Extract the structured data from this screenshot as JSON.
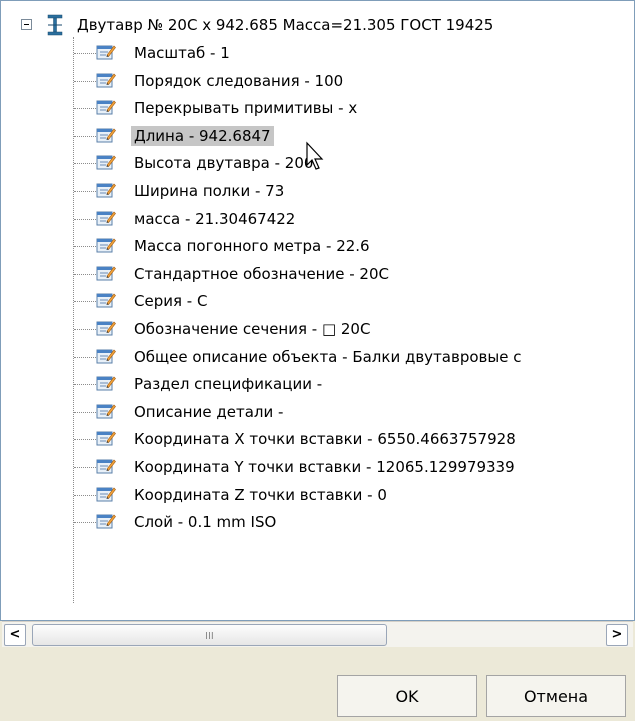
{
  "tree": {
    "root_label": "Двутавр № 20С x 942.685 Масса=21.305 ГОСТ 19425",
    "items": [
      {
        "label": "Масштаб - 1"
      },
      {
        "label": "Порядок следования - 100"
      },
      {
        "label": "Перекрывать примитивы - x"
      },
      {
        "label": "Длина - 942.6847",
        "selected": true
      },
      {
        "label": "Высота двутавра - 200"
      },
      {
        "label": "Ширина полки - 73"
      },
      {
        "label": "масса - 21.30467422"
      },
      {
        "label": "Масса погонного метра - 22.6"
      },
      {
        "label": "Стандартное обозначение - 20С"
      },
      {
        "label": "Серия - С"
      },
      {
        "label": "Обозначение сечения - □ 20С"
      },
      {
        "label": "Общее описание объекта - Балки двутавровые с"
      },
      {
        "label": "Раздел спецификации -"
      },
      {
        "label": "Описание детали -"
      },
      {
        "label": "Координата X точки вставки - 6550.4663757928"
      },
      {
        "label": "Координата Y точки вставки - 12065.129979339"
      },
      {
        "label": "Координата Z точки вставки - 0"
      },
      {
        "label": "Слой - 0.1 mm ISO"
      }
    ]
  },
  "scrollbar": {
    "left_arrow": "<",
    "right_arrow": ">",
    "grip": "III"
  },
  "buttons": {
    "ok": "OK",
    "cancel": "Отмена"
  },
  "icons": {
    "root": "i-beam-icon",
    "item": "property-edit-icon"
  }
}
